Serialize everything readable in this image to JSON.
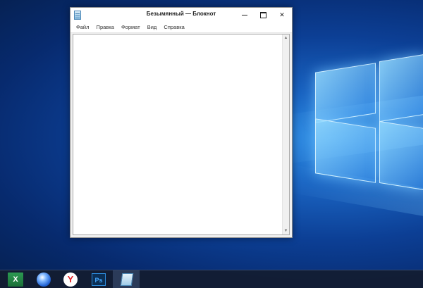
{
  "window": {
    "title": "Безымянный — Блокнот",
    "controls": {
      "minimize": "minimize",
      "maximize": "maximize",
      "close": "✕"
    }
  },
  "menu": {
    "items": [
      "Файл",
      "Правка",
      "Формат",
      "Вид",
      "Справка"
    ]
  },
  "editor": {
    "value": ""
  },
  "taskbar": {
    "items": [
      {
        "name": "excel",
        "label": "X"
      },
      {
        "name": "browser-blue",
        "label": ""
      },
      {
        "name": "yandex-browser",
        "label": ""
      },
      {
        "name": "photoshop",
        "label": "Ps"
      },
      {
        "name": "notepad",
        "label": ""
      }
    ]
  },
  "colors": {
    "accent_yandex": "#e3262b",
    "excel_green": "#1b6f38",
    "photoshop_blue": "#43a6ff"
  }
}
